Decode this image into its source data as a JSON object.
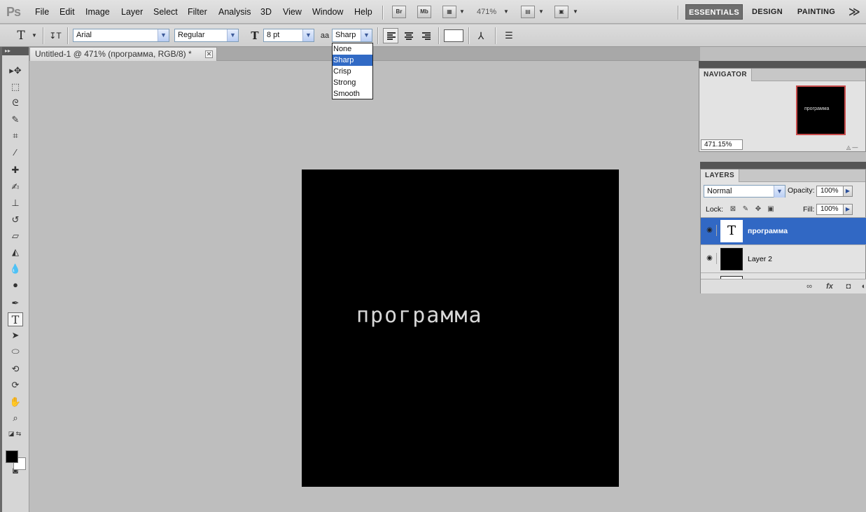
{
  "app": {
    "logo": "Ps",
    "menu": [
      "File",
      "Edit",
      "Image",
      "Layer",
      "Select",
      "Filter",
      "Analysis",
      "3D",
      "View",
      "Window",
      "Help"
    ],
    "bridge_label": "Br",
    "minibridge_label": "Mb",
    "zoom_level": "471%",
    "workspaces": [
      "ESSENTIALS",
      "DESIGN",
      "PAINTING"
    ],
    "active_workspace": "ESSENTIALS",
    "more_label": "≫"
  },
  "options": {
    "tool_glyph": "T",
    "orient_glyph": "↧T",
    "font_family": "Arial",
    "font_style": "Regular",
    "font_size_icon": "T",
    "font_size": "8 pt",
    "aa_icon": "aa",
    "antialias": "Sharp",
    "antialias_options": [
      "None",
      "Sharp",
      "Crisp",
      "Strong",
      "Smooth"
    ],
    "text_color": "#ffffff",
    "warp_glyph": "⅄",
    "panels_glyph": "☰"
  },
  "document": {
    "tab_title": "Untitled-1 @ 471% (программа, RGB/8) *",
    "close_glyph": "✕",
    "canvas_text": "программа",
    "canvas_color": "#000000"
  },
  "toolbox": {
    "header": "▸▸",
    "tools": [
      {
        "name": "move-tool",
        "glyph": "▸✥"
      },
      {
        "name": "marquee-tool",
        "glyph": "⬚"
      },
      {
        "name": "lasso-tool",
        "glyph": "ᘓ"
      },
      {
        "name": "quick-select-tool",
        "glyph": "✎"
      },
      {
        "name": "crop-tool",
        "glyph": "⌗"
      },
      {
        "name": "eyedropper-tool",
        "glyph": "⁄"
      },
      {
        "name": "healing-brush-tool",
        "glyph": "✚"
      },
      {
        "name": "brush-tool",
        "glyph": "✍"
      },
      {
        "name": "clone-stamp-tool",
        "glyph": "⊥"
      },
      {
        "name": "history-brush-tool",
        "glyph": "↺"
      },
      {
        "name": "eraser-tool",
        "glyph": "▱"
      },
      {
        "name": "paint-bucket-tool",
        "glyph": "◭"
      },
      {
        "name": "blur-tool",
        "glyph": "💧"
      },
      {
        "name": "dodge-tool",
        "glyph": "●"
      },
      {
        "name": "pen-tool",
        "glyph": "✒"
      },
      {
        "name": "type-tool",
        "glyph": "T"
      },
      {
        "name": "path-select-tool",
        "glyph": "➤"
      },
      {
        "name": "ellipse-tool",
        "glyph": "⬭"
      },
      {
        "name": "3d-rotate-tool",
        "glyph": "⟲"
      },
      {
        "name": "3d-orbit-tool",
        "glyph": "⟳"
      },
      {
        "name": "hand-tool",
        "glyph": "✋"
      },
      {
        "name": "zoom-tool",
        "glyph": "⌕"
      },
      {
        "name": "default-colors",
        "glyph": "◪ ⇆"
      },
      {
        "name": "quick-mask",
        "glyph": "◙"
      }
    ],
    "active_tool": "type-tool",
    "foreground": "#000000",
    "background": "#ffffff"
  },
  "navigator": {
    "title": "NAVIGATOR",
    "zoom": "471.15%",
    "thumb_text": "программа",
    "slider_glyph": "◬ —"
  },
  "layers": {
    "title": "LAYERS",
    "blend_mode": "Normal",
    "opacity_label": "Opacity:",
    "opacity": "100%",
    "lock_label": "Lock:",
    "fill_label": "Fill:",
    "fill": "100%",
    "items": [
      {
        "name": "программа",
        "type": "text",
        "selected": true
      },
      {
        "name": "Layer 2",
        "type": "fill",
        "selected": false
      }
    ],
    "footer_icons": [
      "link-icon",
      "fx-icon",
      "mask-icon",
      "adjustment-icon"
    ]
  },
  "colors": {
    "accent": "#316ac5",
    "selected_layer": "#3168c4",
    "nav_frame": "#c94c4c"
  }
}
